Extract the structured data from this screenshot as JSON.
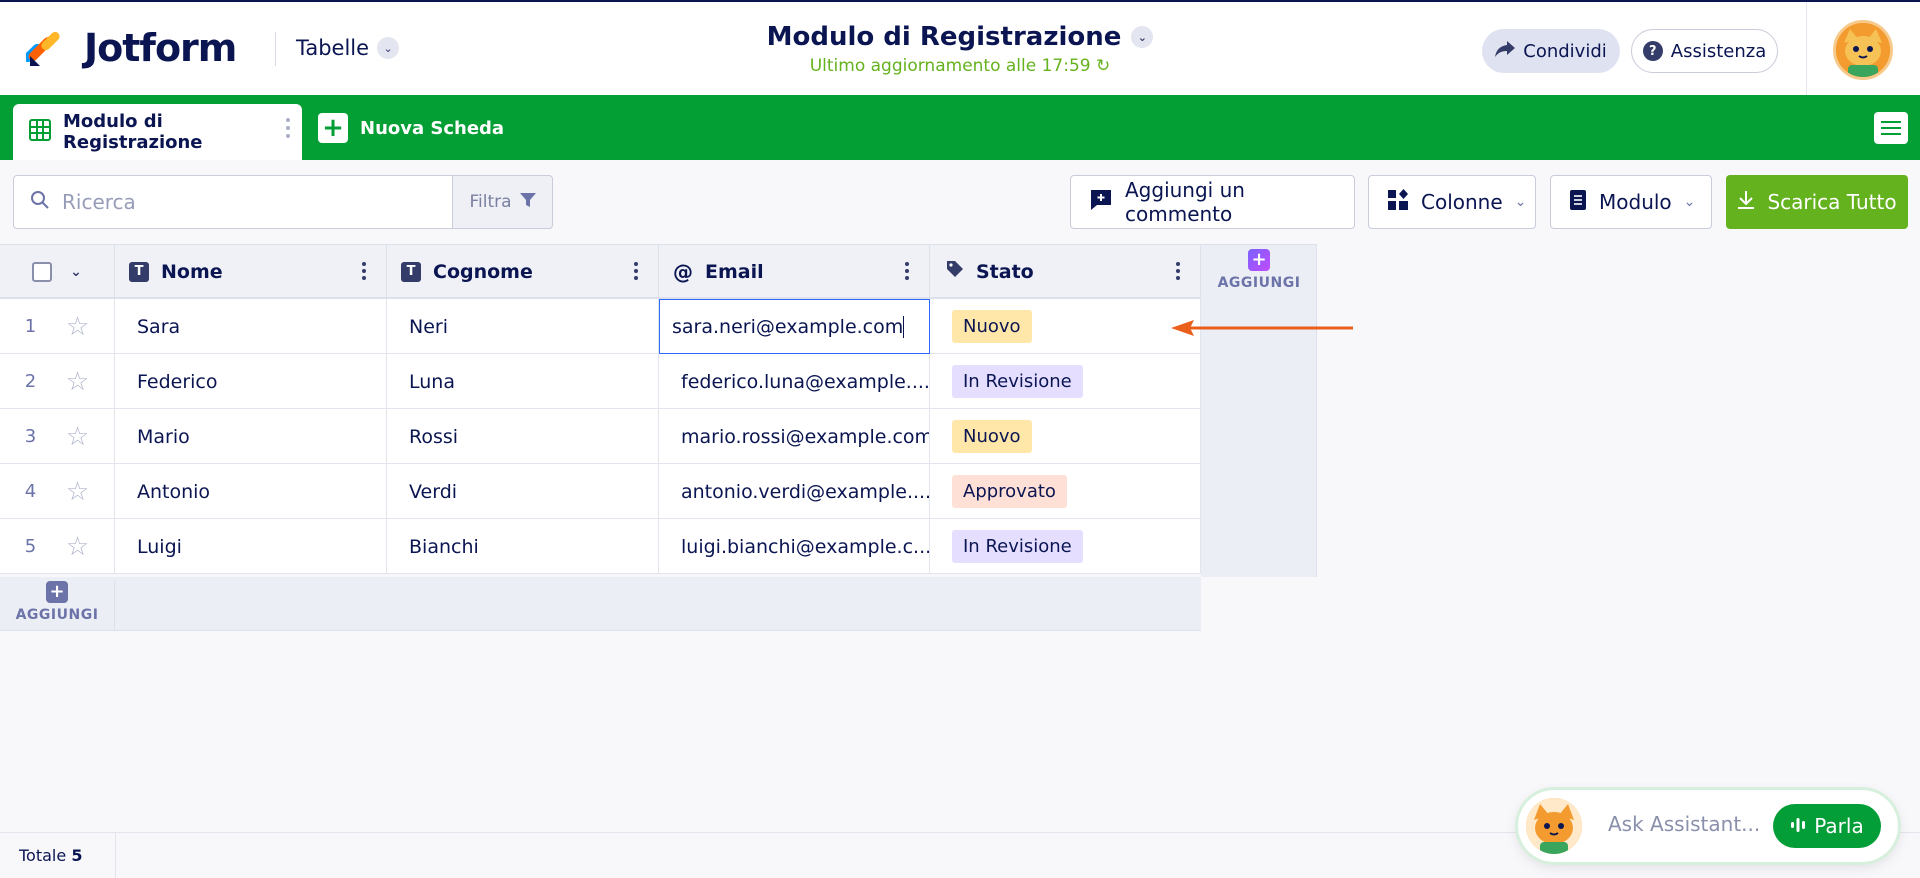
{
  "header": {
    "brand": "Jotform",
    "tables_label": "Tabelle",
    "form_title": "Modulo di Registrazione",
    "last_update": "Ultimo aggiornamento alle 17:59",
    "share_label": "Condividi",
    "help_label": "Assistenza"
  },
  "tabs": {
    "active_label": "Modulo di Registrazione",
    "new_tab_label": "Nuova Scheda"
  },
  "toolbar": {
    "search_placeholder": "Ricerca",
    "filter_label": "Filtra",
    "comment_label": "Aggiungi un commento",
    "columns_label": "Colonne",
    "form_label": "Modulo",
    "download_label": "Scarica Tutto"
  },
  "table": {
    "columns": [
      {
        "label": "Nome",
        "icon": "text-type-icon"
      },
      {
        "label": "Cognome",
        "icon": "text-type-icon"
      },
      {
        "label": "Email",
        "icon": "at-sign-icon"
      },
      {
        "label": "Stato",
        "icon": "tag-icon"
      }
    ],
    "add_label": "AGGIUNGI",
    "rows": [
      {
        "num": "1",
        "nome": "Sara",
        "cognome": "Neri",
        "email": "sara.neri@example.com",
        "stato": "Nuovo",
        "stato_color": "#ffe6a9"
      },
      {
        "num": "2",
        "nome": "Federico",
        "cognome": "Luna",
        "email": "federico.luna@example....",
        "stato": "In Revisione",
        "stato_color": "#e5deff"
      },
      {
        "num": "3",
        "nome": "Mario",
        "cognome": "Rossi",
        "email": "mario.rossi@example.com",
        "stato": "Nuovo",
        "stato_color": "#ffe6a9"
      },
      {
        "num": "4",
        "nome": "Antonio",
        "cognome": "Verdi",
        "email": "antonio.verdi@example....",
        "stato": "Approvato",
        "stato_color": "#ffe0d6"
      },
      {
        "num": "5",
        "nome": "Luigi",
        "cognome": "Bianchi",
        "email": "luigi.bianchi@example.c...",
        "stato": "In Revisione",
        "stato_color": "#e5deff"
      }
    ]
  },
  "footer": {
    "total_label": "Totale",
    "total_count": "5"
  },
  "assistant": {
    "placeholder": "Ask Assistant...",
    "talk_label": "Parla"
  },
  "colors": {
    "brand_green": "#039e34",
    "accent_green": "#64b21e",
    "navy": "#0a1551",
    "arrow_orange": "#ea5f1c"
  }
}
